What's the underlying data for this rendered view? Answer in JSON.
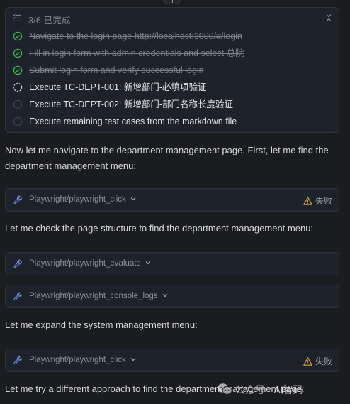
{
  "todo": {
    "progress": "3/6 已完成",
    "items": [
      {
        "label": "Navigate to the login page http://localhost:3000/#/login",
        "status": "done"
      },
      {
        "label": "Fill in login form with admin credentials and select 总院",
        "status": "done"
      },
      {
        "label": "Submit login form and verify successful login",
        "status": "done"
      },
      {
        "label": "Execute TC-DEPT-001: 新增部门-必填项验证",
        "status": "in-progress"
      },
      {
        "label": "Execute TC-DEPT-002: 新增部门-部门名称长度验证",
        "status": "pending"
      },
      {
        "label": "Execute remaining test cases from the markdown file",
        "status": "pending"
      }
    ]
  },
  "messages": [
    {
      "text": "Now let me navigate to the department management page. First, let me find the department management menu:"
    },
    {
      "text": "Let me check the page structure to find the department management menu:"
    },
    {
      "text": "Let me expand the system management menu:"
    },
    {
      "text": "Let me try a different approach to find the department management page:"
    }
  ],
  "tools": [
    {
      "name": "Playwright/playwright_click",
      "status": "失败"
    },
    {
      "name": "Playwright/playwright_evaluate",
      "status": ""
    },
    {
      "name": "Playwright/playwright_console_logs",
      "status": ""
    },
    {
      "name": "Playwright/playwright_click",
      "status": "失败"
    }
  ],
  "watermark": {
    "text": "公众号 · AI智码"
  },
  "colors": {
    "background": "#1b1c1f",
    "card": "#1e222b",
    "done_green": "#3fb950",
    "warning": "#d6a13a",
    "icon_blue": "#6f8fd8"
  },
  "icons": {
    "todo_header": "checklist-icon",
    "collapse": "collapse-arrows-icon",
    "done": "check-circle-icon",
    "in_progress": "dashed-circle-icon",
    "pending": "empty-circle-icon",
    "tool": "wrench-icon",
    "fail": "warning-triangle-icon"
  }
}
